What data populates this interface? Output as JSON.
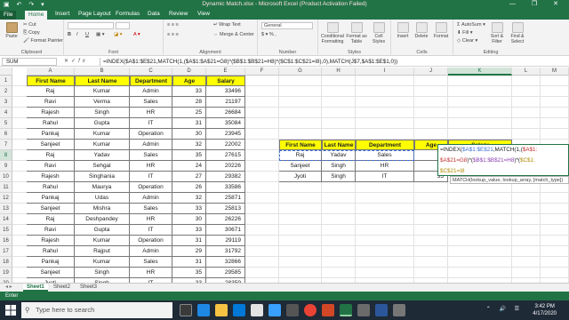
{
  "window": {
    "title": "Dynamic Match.xlsx - Microsoft Excel (Product Activation Failed)",
    "controls": [
      "—",
      "❐",
      "✕"
    ]
  },
  "tabs": [
    "File",
    "Home",
    "Insert",
    "Page Layout",
    "Formulas",
    "Data",
    "Review",
    "View"
  ],
  "ribbon": {
    "clipboard": {
      "paste": "Paste",
      "cut": "Cut",
      "copy": "Copy",
      "format_painter": "Format Painter",
      "label": "Clipboard"
    },
    "font": {
      "label": "Font",
      "bold": "B",
      "italic": "I",
      "underline": "U"
    },
    "alignment": {
      "wrap": "Wrap Text",
      "merge": "Merge & Center",
      "label": "Alignment"
    },
    "number": {
      "format": "General",
      "label": "Number"
    },
    "styles": {
      "conditional": "Conditional Formatting",
      "format_table": "Format as Table",
      "cell_styles": "Cell Styles",
      "label": "Styles"
    },
    "cells": {
      "insert": "Insert",
      "delete": "Delete",
      "format": "Format",
      "label": "Cells"
    },
    "editing": {
      "autosum": "AutoSum",
      "fill": "Fill",
      "clear": "Clear",
      "sort": "Sort & Filter",
      "find": "Find & Select",
      "label": "Editing"
    }
  },
  "formula_bar": {
    "name_box": "SUM",
    "formula": "=INDEX($A$1:$E$21,MATCH(1,($A$1:$A$21=G8)*($B$1:$B$21=H8)*($C$1:$C$21=I8),0),MATCH(J$7,$A$1:$E$1,0))"
  },
  "columns": [
    "A",
    "B",
    "C",
    "D",
    "E",
    "F",
    "G",
    "H",
    "I",
    "J",
    "K",
    "L",
    "M",
    "N"
  ],
  "rows": [
    "1",
    "2",
    "3",
    "4",
    "5",
    "6",
    "7",
    "8",
    "9",
    "10",
    "11",
    "12",
    "13",
    "14",
    "15",
    "16",
    "17",
    "18",
    "19",
    "20",
    "21"
  ],
  "table": {
    "headers": [
      "First Name",
      "Last Name",
      "Department",
      "Age",
      "Salary"
    ],
    "rows": [
      [
        "Raj",
        "Kumar",
        "Admin",
        "33",
        "33496"
      ],
      [
        "Ravi",
        "Verma",
        "Sales",
        "28",
        "21197"
      ],
      [
        "Rajesh",
        "Singh",
        "HR",
        "25",
        "26684"
      ],
      [
        "Rahul",
        "Gupta",
        "IT",
        "31",
        "35084"
      ],
      [
        "Pankaj",
        "Kumar",
        "Operation",
        "30",
        "23945"
      ],
      [
        "Sanjeet",
        "Kumar",
        "Admin",
        "32",
        "22002"
      ],
      [
        "Raj",
        "Yadav",
        "Sales",
        "35",
        "27615"
      ],
      [
        "Ravi",
        "Sehgal",
        "HR",
        "24",
        "20226"
      ],
      [
        "Rajesh",
        "Singhania",
        "IT",
        "27",
        "29382"
      ],
      [
        "Rahul",
        "Maurya",
        "Operation",
        "26",
        "33586"
      ],
      [
        "Pankaj",
        "Udas",
        "Admin",
        "32",
        "25871"
      ],
      [
        "Sanjeet",
        "Mishra",
        "Sales",
        "33",
        "25813"
      ],
      [
        "Raj",
        "Deshpandey",
        "HR",
        "30",
        "26226"
      ],
      [
        "Ravi",
        "Gupta",
        "IT",
        "33",
        "30671"
      ],
      [
        "Rajesh",
        "Kumar",
        "Operation",
        "31",
        "29119"
      ],
      [
        "Rahul",
        "Rajput",
        "Admin",
        "29",
        "31792"
      ],
      [
        "Pankaj",
        "Kumar",
        "Sales",
        "31",
        "32866"
      ],
      [
        "Sanjeet",
        "Singh",
        "HR",
        "35",
        "29585"
      ],
      [
        "Jyoti",
        "Singh",
        "IT",
        "33",
        "28359"
      ],
      [
        "Sanjeet",
        "Mishra",
        "Operation",
        "35",
        "31787"
      ]
    ]
  },
  "lookup": {
    "headers": [
      "First Name",
      "Last Name",
      "Department",
      "Age",
      "Salary"
    ],
    "rows": [
      [
        "Raj",
        "Yadav",
        "Sales",
        "33"
      ],
      [
        "Sanjeet",
        "Singh",
        "HR",
        "35"
      ],
      [
        "Jyoti",
        "Singh",
        "IT",
        "35"
      ]
    ]
  },
  "edit_cell": {
    "part1": "=INDEX(",
    "part2": "$A$1:$E$21",
    "part3": ",MATCH(1,(",
    "part4": "$A$1:",
    "part5": "$A$21=G8",
    "part6": ")*(",
    "part7": "$B$1:$B$21=H8",
    "part8": ")*(",
    "part9": "$C$1:",
    "part10": "$C$21=I8"
  },
  "tooltip": "MATCH(lookup_value, lookup_array, [match_type])",
  "sheets": [
    "Sheet1",
    "Sheet2",
    "Sheet3"
  ],
  "status": "Enter",
  "taskbar": {
    "search_placeholder": "Type here to search",
    "time": "3:42 PM",
    "date": "4/17/2020"
  },
  "colors": {
    "excel_green": "#217346",
    "header_yellow": "#ffff00"
  }
}
